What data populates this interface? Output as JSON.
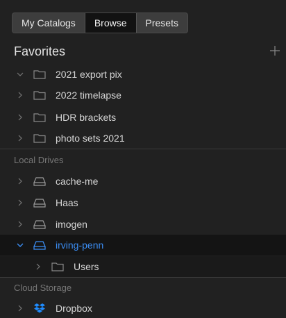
{
  "tabs": [
    {
      "label": "My Catalogs",
      "active": false
    },
    {
      "label": "Browse",
      "active": true
    },
    {
      "label": "Presets",
      "active": false
    }
  ],
  "favorites": {
    "title": "Favorites",
    "add_icon": "plus-icon",
    "items": [
      {
        "label": "2021 export pix",
        "expanded": true,
        "icon": "folder-icon"
      },
      {
        "label": "2022 timelapse",
        "expanded": false,
        "icon": "folder-icon"
      },
      {
        "label": "HDR brackets",
        "expanded": false,
        "icon": "folder-icon"
      },
      {
        "label": "photo sets 2021",
        "expanded": false,
        "icon": "folder-icon"
      }
    ]
  },
  "local_drives": {
    "title": "Local Drives",
    "items": [
      {
        "label": "cache-me",
        "icon": "drive-icon",
        "expanded": false
      },
      {
        "label": "Haas",
        "icon": "drive-icon",
        "expanded": false
      },
      {
        "label": "imogen",
        "icon": "drive-icon",
        "expanded": false
      },
      {
        "label": "irving-penn",
        "icon": "drive-icon",
        "expanded": true,
        "selected": true
      },
      {
        "label": "Users",
        "icon": "folder-icon",
        "expanded": false,
        "child": true
      }
    ]
  },
  "cloud_storage": {
    "title": "Cloud Storage",
    "items": [
      {
        "label": "Dropbox",
        "icon": "dropbox-icon",
        "expanded": false
      }
    ]
  },
  "colors": {
    "accent": "#3b8df3",
    "background": "#212121"
  }
}
